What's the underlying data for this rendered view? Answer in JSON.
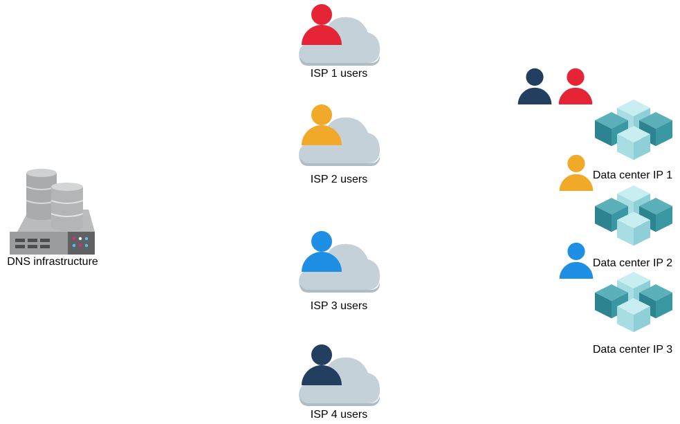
{
  "colors": {
    "red": "#e52535",
    "orange": "#f0a929",
    "blue": "#1f8fe5",
    "navy": "#233f5f",
    "cloud": "#c5d1d9",
    "cloud_shadow": "#aebcc6"
  },
  "dns": {
    "label": "DNS infrastructure",
    "icon": "database-server-icon"
  },
  "isps": [
    {
      "label": "ISP 1 users",
      "color": "red"
    },
    {
      "label": "ISP 2 users",
      "color": "orange"
    },
    {
      "label": "ISP 3 users",
      "color": "blue"
    },
    {
      "label": "ISP 4 users",
      "color": "navy"
    }
  ],
  "datacenters": [
    {
      "label": "Data center IP 1"
    },
    {
      "label": "Data center IP 2"
    },
    {
      "label": "Data center IP 3"
    }
  ],
  "dc_users": [
    "navy",
    "red",
    "orange",
    "blue"
  ]
}
